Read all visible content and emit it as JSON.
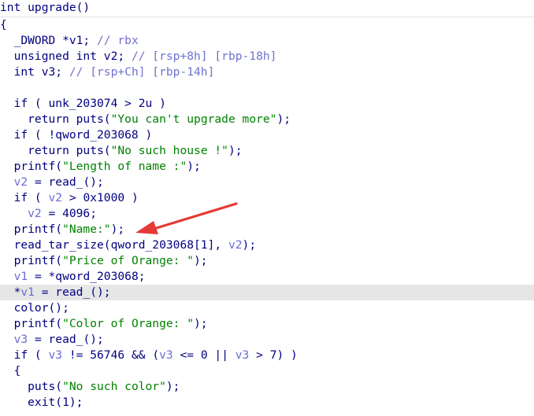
{
  "pseudocode": {
    "lines": [
      [
        [
          "id",
          "int upgrade()"
        ]
      ],
      [
        [
          "pun",
          "{"
        ]
      ],
      [
        [
          "id",
          "  _DWORD *v1; "
        ],
        [
          "cmt",
          "// rbx"
        ]
      ],
      [
        [
          "id",
          "  unsigned int v2; "
        ],
        [
          "cmt",
          "// [rsp+8h] [rbp-18h]"
        ]
      ],
      [
        [
          "id",
          "  int v3; "
        ],
        [
          "cmt",
          "// [rsp+Ch] [rbp-14h]"
        ]
      ],
      [
        [
          "id",
          ""
        ]
      ],
      [
        [
          "id",
          "  if ( unk_203074 > 2u )"
        ]
      ],
      [
        [
          "id",
          "    return puts("
        ],
        [
          "str",
          "\"You can't upgrade more\""
        ],
        [
          "id",
          ");"
        ]
      ],
      [
        [
          "id",
          "  if ( !qword_203068 )"
        ]
      ],
      [
        [
          "id",
          "    return puts("
        ],
        [
          "str",
          "\"No such house !\""
        ],
        [
          "id",
          ");"
        ]
      ],
      [
        [
          "id",
          "  printf("
        ],
        [
          "str",
          "\"Length of name :\""
        ],
        [
          "id",
          ");"
        ]
      ],
      [
        [
          "var",
          "  v2"
        ],
        [
          "id",
          " = read_();"
        ]
      ],
      [
        [
          "id",
          "  if ( "
        ],
        [
          "var",
          "v2"
        ],
        [
          "id",
          " > 0x1000 )"
        ]
      ],
      [
        [
          "var",
          "    v2"
        ],
        [
          "id",
          " = 4096;"
        ]
      ],
      [
        [
          "id",
          "  printf("
        ],
        [
          "str",
          "\"Name:\""
        ],
        [
          "id",
          ");"
        ]
      ],
      [
        [
          "id",
          "  read_tar_size(qword_203068[1], "
        ],
        [
          "var",
          "v2"
        ],
        [
          "id",
          ");"
        ]
      ],
      [
        [
          "id",
          "  printf("
        ],
        [
          "str",
          "\"Price of Orange: \""
        ],
        [
          "id",
          ");"
        ]
      ],
      [
        [
          "var",
          "  v1"
        ],
        [
          "id",
          " = *qword_203068;"
        ]
      ],
      [
        [
          "id",
          "  *"
        ],
        [
          "var",
          "v1"
        ],
        [
          "id",
          " = read_();"
        ]
      ],
      [
        [
          "id",
          "  color();"
        ]
      ],
      [
        [
          "id",
          "  printf("
        ],
        [
          "str",
          "\"Color of Orange: \""
        ],
        [
          "id",
          ");"
        ]
      ],
      [
        [
          "var",
          "  v3"
        ],
        [
          "id",
          " = read_();"
        ]
      ],
      [
        [
          "id",
          "  if ( "
        ],
        [
          "var",
          "v3"
        ],
        [
          "id",
          " != 56746 && ("
        ],
        [
          "var",
          "v3"
        ],
        [
          "id",
          " <= 0 || "
        ],
        [
          "var",
          "v3"
        ],
        [
          "id",
          " > 7) )"
        ]
      ],
      [
        [
          "id",
          "  {"
        ]
      ],
      [
        [
          "id",
          "    puts("
        ],
        [
          "str",
          "\"No such color\""
        ],
        [
          "id",
          ");"
        ]
      ],
      [
        [
          "id",
          "    exit(1);"
        ]
      ]
    ],
    "current_line_index": 18
  },
  "colors": {
    "text": "#000080",
    "variable": "#6a6ad8",
    "string": "#008000",
    "comment": "#7070d0",
    "highlight": "#e6e6e6",
    "arrow": "#e53935"
  },
  "annotation": {
    "arrow_points_to_line_index": 14
  }
}
